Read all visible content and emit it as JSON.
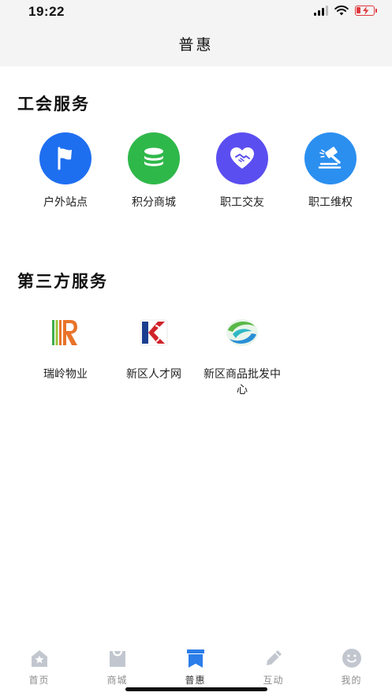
{
  "status_bar": {
    "time": "19:22"
  },
  "header": {
    "title": "普惠"
  },
  "union_services": {
    "title": "工会服务",
    "items": [
      {
        "label": "户外站点",
        "icon": "flag-icon",
        "color": "#1e6ff0"
      },
      {
        "label": "积分商城",
        "icon": "coin-stack-icon",
        "color": "#2fb84a"
      },
      {
        "label": "职工交友",
        "icon": "heart-handshake-icon",
        "color": "#5b4ef0"
      },
      {
        "label": "职工维权",
        "icon": "gavel-icon",
        "color": "#2b8ff0"
      }
    ]
  },
  "third_party_services": {
    "title": "第三方服务",
    "items": [
      {
        "label": "瑞岭物业",
        "icon": "ruiling-logo"
      },
      {
        "label": "新区人才网",
        "icon": "talent-network-logo"
      },
      {
        "label": "新区商品批发中心",
        "icon": "wholesale-center-logo"
      }
    ]
  },
  "tab_bar": {
    "active_color": "#2b7de9",
    "inactive_color": "#c2c7cf",
    "tabs": [
      {
        "label": "首页",
        "icon": "home-icon",
        "active": false
      },
      {
        "label": "商城",
        "icon": "shopping-bag-icon",
        "active": false
      },
      {
        "label": "普惠",
        "icon": "bookmark-icon",
        "active": true
      },
      {
        "label": "互动",
        "icon": "pencil-icon",
        "active": false
      },
      {
        "label": "我的",
        "icon": "smiley-face-icon",
        "active": false
      }
    ]
  }
}
